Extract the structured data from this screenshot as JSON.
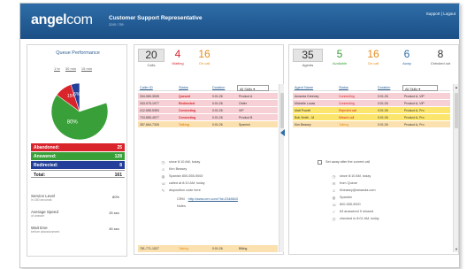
{
  "header": {
    "logo_prefix": "angel",
    "logo_suffix": "com",
    "title": "Customer Support Representative",
    "subtitle": "3245 / 789",
    "links": "Support | Logout"
  },
  "queue": {
    "title": "Queue Performance",
    "ranges": [
      "1 hr",
      "30 min",
      "15 min"
    ],
    "pie": {
      "answered_pct": "80%",
      "abandoned_pct": "15%",
      "redirected_pct": "5%",
      "values": [
        80,
        15,
        5
      ],
      "colors": [
        "#39a039",
        "#d9242b",
        "#233f99"
      ]
    },
    "stats": {
      "abandoned": {
        "label": "Abandoned:",
        "value": "25"
      },
      "answered": {
        "label": "Answered:",
        "value": "128"
      },
      "redirected": {
        "label": "Redirected:",
        "value": "8"
      },
      "total": {
        "label": "Total:",
        "value": "161"
      }
    },
    "metrics": [
      {
        "label": "Service Level",
        "sub": "in 180 seconds",
        "value": "80%"
      },
      {
        "label": "Average Speed",
        "sub": "of answer",
        "value": "25 sec"
      },
      {
        "label": "Wait time",
        "sub": "before abandonment",
        "value": "45 sec"
      }
    ]
  },
  "calls": {
    "counts": [
      {
        "n": "20",
        "label": "Calls",
        "color": "#333"
      },
      {
        "n": "4",
        "label": "Waiting",
        "color": "#d9242b"
      },
      {
        "n": "16",
        "label": "On call",
        "color": "#e58c1a"
      }
    ],
    "headers": {
      "caller": "Caller ID",
      "status": "Status",
      "duration": "Duration",
      "skills": "All Skills"
    },
    "rows": [
      {
        "caller": "334-969-3535",
        "status": "Queued",
        "duration": "0:01:26",
        "skill": "Product A",
        "style": "pink"
      },
      {
        "caller": "343-975-1977",
        "status": "Redirected",
        "duration": "0:01:26",
        "skill": "Order",
        "style": "pink"
      },
      {
        "caller": "412-555-5353",
        "status": "Connecting",
        "duration": "0:01:26",
        "skill": "VIP",
        "style": "pink"
      },
      {
        "caller": "703-855-4577",
        "status": "Connecting",
        "duration": "0:01:26",
        "skill": "Product B",
        "style": "pink"
      },
      {
        "caller": "357-664-7326",
        "status": "Talking",
        "duration": "0:01:26",
        "skill": "Spanish",
        "style": "yel"
      }
    ],
    "detail": [
      {
        "icon": "clock-icon",
        "text": "since 8:10 AM, today"
      },
      {
        "icon": "person-icon",
        "text": "Kim Beasey"
      },
      {
        "icon": "globe-icon",
        "text": "Spanish   800-555-9000"
      },
      {
        "icon": "phone-icon",
        "text": "called at 8:10 AM, today"
      },
      {
        "icon": "edit-icon",
        "text": "disposition code here"
      }
    ],
    "crm_label": "CRM",
    "crm_link": "http://www.crm.com/?id=2348843",
    "notes_label": "Notes",
    "bottom_row": {
      "caller": "781-771-1527",
      "status": "Talking",
      "duration": "0:01:26",
      "skill": "Billing"
    }
  },
  "agents": {
    "counts": [
      {
        "n": "35",
        "label": "Agents",
        "color": "#333"
      },
      {
        "n": "5",
        "label": "Available",
        "color": "#39a039"
      },
      {
        "n": "16",
        "label": "On call",
        "color": "#e58c1a"
      },
      {
        "n": "6",
        "label": "Away",
        "color": "#2e6da8"
      },
      {
        "n": "8",
        "label": "Checked out",
        "color": "#333"
      }
    ],
    "headers": {
      "name": "Agent Name",
      "status": "Status",
      "duration": "Duration",
      "skills": "All Skills"
    },
    "rows": [
      {
        "name": "Amanda Greeney",
        "status": "Connecting",
        "duration": "0:01:26",
        "skill": "Product A, VIP",
        "style": "pink"
      },
      {
        "name": "Michelle Lucas",
        "status": "Connecting",
        "duration": "0:01:26",
        "skill": "Product A, VIP",
        "style": "pink"
      },
      {
        "name": "Matt Powell",
        "status": "Rejected call",
        "duration": "0:01:26",
        "skill": "Product A, Pro",
        "style": "yellow2"
      },
      {
        "name": "Bob Smith - M",
        "status": "Missed call",
        "duration": "0:01:26",
        "skill": "Product A, Pro",
        "style": "yellow2"
      },
      {
        "name": "Kim Beasey",
        "status": "Talking",
        "duration": "0:01:26",
        "skill": "Product A, Pro",
        "style": "yel"
      }
    ],
    "away_checkbox": "Set away after the current call",
    "detail": [
      {
        "icon": "clock-icon",
        "text": "since 8:10 AM, today"
      },
      {
        "icon": "mail-icon",
        "text": "from Queue"
      },
      {
        "icon": "person-icon",
        "text": "Kbeasey@amanda.com"
      },
      {
        "icon": "globe-icon",
        "text": "Spanish"
      },
      {
        "icon": "phone-icon",
        "text": "800-555-9000"
      },
      {
        "icon": "check-icon",
        "text": "63 answered      9 missed"
      },
      {
        "icon": "clock-icon",
        "text": "checked in 8:01 AM, today"
      }
    ]
  }
}
